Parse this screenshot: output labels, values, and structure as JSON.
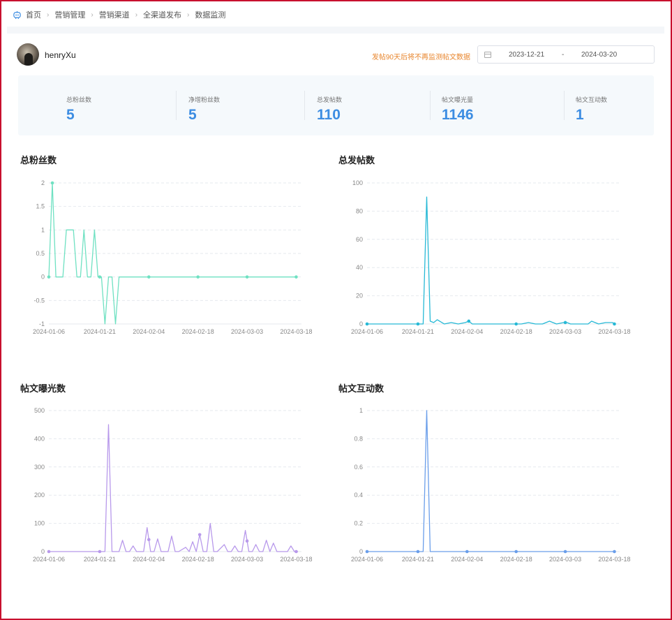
{
  "breadcrumb": {
    "icon": "robot-home-icon",
    "items": [
      "首页",
      "营销管理",
      "营销渠道",
      "全渠道发布",
      "数据监测"
    ]
  },
  "user": {
    "name": "henryXu",
    "hint": "发帖90天后将不再监测帖文数据",
    "date_start": "2023-12-21",
    "date_sep": "-",
    "date_end": "2024-03-20"
  },
  "stats": [
    {
      "label": "总粉丝数",
      "value": "5"
    },
    {
      "label": "净增粉丝数",
      "value": "5"
    },
    {
      "label": "总发帖数",
      "value": "110"
    },
    {
      "label": "帖文曝光量",
      "value": "1146"
    },
    {
      "label": "帖文互动数",
      "value": "1"
    }
  ],
  "colors": {
    "accent": "#3d8de2",
    "hint": "#e8862e",
    "fans": "#6fe1c2",
    "posts": "#27b9d6",
    "exposure": "#b899eb",
    "interaction": "#6a9eea"
  },
  "chart_data": [
    {
      "type": "line",
      "title": "总粉丝数",
      "xlim": [
        0,
        72
      ],
      "ylim": [
        -1,
        2
      ],
      "y_ticks": [
        "-1",
        "-0.5",
        "0",
        "0.5",
        "1",
        "1.5",
        "2"
      ],
      "y_tick_values": [
        -1,
        -0.5,
        0,
        0.5,
        1,
        1.5,
        2
      ],
      "x_ticks": [
        "2024-01-06",
        "2024-01-21",
        "2024-02-04",
        "2024-02-18",
        "2024-03-03",
        "2024-03-18"
      ],
      "x_tick_values": [
        0,
        14.5,
        28.5,
        42.5,
        56.5,
        70.5
      ],
      "series": [
        {
          "x": [
            0,
            1,
            2,
            4,
            5,
            7,
            8,
            9,
            10,
            11,
            12,
            13,
            14,
            15,
            16,
            17,
            18,
            19,
            20,
            21,
            22,
            28.5,
            42.5,
            56.5,
            70.5
          ],
          "y": [
            0,
            2,
            0,
            0,
            1,
            1,
            0,
            0,
            1,
            0,
            0,
            1,
            0,
            0,
            -1,
            0,
            0,
            -1,
            0,
            0,
            0,
            0,
            0,
            0,
            0
          ]
        }
      ],
      "markers_x": [
        0,
        1,
        14.5,
        28.5,
        42.5,
        56.5,
        70.5
      ]
    },
    {
      "type": "line",
      "title": "总发帖数",
      "xlim": [
        0,
        72
      ],
      "ylim": [
        0,
        100
      ],
      "y_ticks": [
        "0",
        "20",
        "40",
        "60",
        "80",
        "100"
      ],
      "y_tick_values": [
        0,
        20,
        40,
        60,
        80,
        100
      ],
      "x_ticks": [
        "2024-01-06",
        "2024-01-21",
        "2024-02-04",
        "2024-02-18",
        "2024-03-03",
        "2024-03-18"
      ],
      "x_tick_values": [
        0,
        14.5,
        28.5,
        42.5,
        56.5,
        70.5
      ],
      "series": [
        {
          "x": [
            0,
            14.5,
            16,
            17,
            18,
            19,
            20,
            22,
            24,
            26,
            28,
            29,
            30,
            36,
            40,
            42.5,
            44,
            46,
            48,
            50,
            52,
            54,
            56,
            57,
            58,
            60,
            63,
            64,
            66,
            68,
            70,
            70.5
          ],
          "y": [
            0,
            0,
            0,
            90,
            2,
            1,
            3,
            0,
            1,
            0,
            1,
            2,
            0,
            0,
            0,
            0,
            0,
            1,
            0,
            0,
            2,
            0,
            1,
            1,
            0,
            0,
            0,
            2,
            0,
            1,
            1,
            0
          ]
        }
      ],
      "markers_x": [
        0,
        14.5,
        29,
        42.5,
        56.5,
        70.5
      ]
    },
    {
      "type": "line",
      "title": "帖文曝光数",
      "xlim": [
        0,
        72
      ],
      "ylim": [
        0,
        500
      ],
      "y_ticks": [
        "0",
        "100",
        "200",
        "300",
        "400",
        "500"
      ],
      "y_tick_values": [
        0,
        100,
        200,
        300,
        400,
        500
      ],
      "x_ticks": [
        "2024-01-06",
        "2024-01-21",
        "2024-02-04",
        "2024-02-18",
        "2024-03-03",
        "2024-03-18"
      ],
      "x_tick_values": [
        0,
        14.5,
        28.5,
        42.5,
        56.5,
        70.5
      ],
      "series": [
        {
          "x": [
            0,
            14.5,
            16,
            17,
            18,
            20,
            21,
            22,
            23,
            24,
            25,
            27,
            28,
            29,
            30,
            31,
            32,
            34,
            35,
            36,
            37,
            39,
            40,
            41,
            42,
            43,
            44,
            45,
            46,
            47,
            48,
            50,
            51,
            52,
            53,
            54,
            55,
            56,
            57,
            58,
            59,
            60,
            61,
            62,
            63,
            64,
            65,
            66,
            68,
            69,
            70,
            71
          ],
          "y": [
            0,
            0,
            0,
            450,
            0,
            0,
            40,
            0,
            0,
            20,
            0,
            0,
            85,
            0,
            0,
            45,
            0,
            0,
            55,
            0,
            0,
            15,
            0,
            35,
            0,
            60,
            0,
            0,
            100,
            0,
            0,
            25,
            0,
            0,
            20,
            0,
            0,
            75,
            0,
            0,
            25,
            0,
            0,
            40,
            0,
            30,
            0,
            0,
            0,
            20,
            0,
            0
          ]
        }
      ],
      "markers_x": [
        0,
        14.5,
        28.5,
        43,
        56.5,
        70.5
      ]
    },
    {
      "type": "line",
      "title": "帖文互动数",
      "xlim": [
        0,
        72
      ],
      "ylim": [
        0,
        1
      ],
      "y_ticks": [
        "0",
        "0.2",
        "0.4",
        "0.6",
        "0.8",
        "1"
      ],
      "y_tick_values": [
        0,
        0.2,
        0.4,
        0.6,
        0.8,
        1
      ],
      "x_ticks": [
        "2024-01-06",
        "2024-01-21",
        "2024-02-04",
        "2024-02-18",
        "2024-03-03",
        "2024-03-18"
      ],
      "x_tick_values": [
        0,
        14.5,
        28.5,
        42.5,
        56.5,
        70.5
      ],
      "series": [
        {
          "x": [
            0,
            14.5,
            16,
            17,
            18,
            28.5,
            42.5,
            56.5,
            70.5
          ],
          "y": [
            0,
            0,
            0,
            1,
            0,
            0,
            0,
            0,
            0
          ]
        }
      ],
      "markers_x": [
        0,
        14.5,
        28.5,
        42.5,
        56.5,
        70.5
      ]
    }
  ]
}
